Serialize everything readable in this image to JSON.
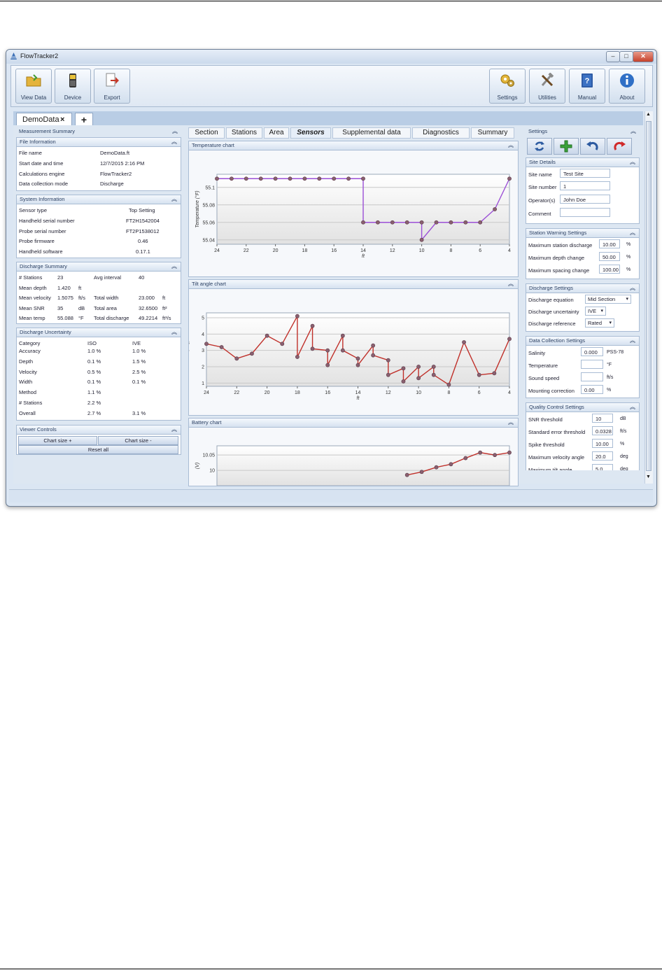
{
  "window": {
    "title": "FlowTracker2",
    "min": "–",
    "max": "□",
    "close": "✕"
  },
  "toolbar": {
    "left": [
      {
        "label": "View Data",
        "icon": "folder-icon"
      },
      {
        "label": "Device",
        "icon": "handheld-device-icon"
      },
      {
        "label": "Export",
        "icon": "export-icon"
      }
    ],
    "right": [
      {
        "label": "Settings",
        "icon": "settings-gears-icon"
      },
      {
        "label": "Utilities",
        "icon": "tools-icon"
      },
      {
        "label": "Manual",
        "icon": "manual-book-icon"
      },
      {
        "label": "About",
        "icon": "info-icon"
      }
    ]
  },
  "doc_tab": {
    "label": "DemoData",
    "close": "×",
    "add": "+"
  },
  "measurement_summary": {
    "title": "Measurement Summary"
  },
  "file_information": {
    "title": "File Information",
    "rows": [
      {
        "k": "File name",
        "v": "DemoData.ft"
      },
      {
        "k": "Start date and time",
        "v": "12/7/2015 2:16 PM"
      },
      {
        "k": "Calculations engine",
        "v": "FlowTracker2"
      },
      {
        "k": "Data collection mode",
        "v": "Discharge"
      }
    ]
  },
  "system_information": {
    "title": "System Information",
    "rows": [
      {
        "k": "Sensor type",
        "v": "Top Setting"
      },
      {
        "k": "Handheld serial number",
        "v": "FT2H1542004"
      },
      {
        "k": "Probe serial number",
        "v": "FT2P1538012"
      },
      {
        "k": "Probe firmware",
        "v": "0.46"
      },
      {
        "k": "Handheld software",
        "v": "0.17.1"
      }
    ]
  },
  "discharge_summary": {
    "title": "Discharge Summary",
    "rows": [
      {
        "k1": "# Stations",
        "v1": "23",
        "u1": "",
        "k2": "Avg interval",
        "v2": "40",
        "u2": ""
      },
      {
        "k1": "Mean depth",
        "v1": "1.420",
        "u1": "ft",
        "k2": "",
        "v2": "",
        "u2": ""
      },
      {
        "k1": "Mean velocity",
        "v1": "1.5075",
        "u1": "ft/s",
        "k2": "Total width",
        "v2": "23.000",
        "u2": "ft"
      },
      {
        "k1": "Mean SNR",
        "v1": "35",
        "u1": "dB",
        "k2": "Total area",
        "v2": "32.6500",
        "u2": "ft²"
      },
      {
        "k1": "Mean temp",
        "v1": "55.088",
        "u1": "°F",
        "k2": "Total discharge",
        "v2": "49.2214",
        "u2": "ft³/s"
      }
    ]
  },
  "discharge_uncertainty": {
    "title": "Discharge Uncertainty",
    "header": {
      "c": "Category",
      "a": "ISO",
      "b": "IVE"
    },
    "rows": [
      {
        "c": "Accuracy",
        "a": "1.0 %",
        "b": "1.0 %"
      },
      {
        "c": "Depth",
        "a": "0.1 %",
        "b": "1.5 %"
      },
      {
        "c": "Velocity",
        "a": "0.5 %",
        "b": "2.5 %"
      },
      {
        "c": "Width",
        "a": "0.1 %",
        "b": "0.1 %"
      },
      {
        "c": "Method",
        "a": "1.1 %",
        "b": ""
      },
      {
        "c": "# Stations",
        "a": "2.2 %",
        "b": ""
      },
      {
        "c": "Overall",
        "a": "2.7 %",
        "b": "3.1 %"
      }
    ]
  },
  "viewer_controls": {
    "title": "Viewer Controls",
    "chart_size_plus": "Chart size +",
    "chart_size_minus": "Chart size -",
    "reset": "Reset all"
  },
  "center_tabs": [
    "Section",
    "Stations",
    "Area",
    "Sensors",
    "Supplemental data",
    "Diagnostics",
    "Summary"
  ],
  "active_center_tab": "Sensors",
  "chart_data": [
    {
      "type": "line",
      "title": "Temperature chart",
      "xlabel": "ft",
      "ylabel": "Temperature (°F)",
      "x_ticks": [
        "24",
        "22",
        "20",
        "18",
        "16",
        "14",
        "12",
        "10",
        "8",
        "6",
        "4"
      ],
      "y_ticks": [
        "55.04",
        "55.06",
        "55.08",
        "55.1"
      ],
      "xlim": [
        24,
        4
      ],
      "ylim": [
        55.035,
        55.115
      ],
      "color": "#9b4fd6",
      "x": [
        24,
        23,
        22,
        21,
        20,
        19,
        18,
        17,
        16,
        15,
        14,
        14,
        13,
        12,
        11,
        10,
        10,
        9,
        8,
        7,
        6,
        5,
        4
      ],
      "y": [
        55.11,
        55.11,
        55.11,
        55.11,
        55.11,
        55.11,
        55.11,
        55.11,
        55.11,
        55.11,
        55.11,
        55.06,
        55.06,
        55.06,
        55.06,
        55.06,
        55.04,
        55.06,
        55.06,
        55.06,
        55.06,
        55.075,
        55.11
      ]
    },
    {
      "type": "line",
      "title": "Tilt angle chart",
      "xlabel": "ft",
      "ylabel": "Tilt (deg)",
      "x_ticks": [
        "24",
        "22",
        "20",
        "18",
        "16",
        "14",
        "12",
        "10",
        "8",
        "6",
        "4"
      ],
      "y_ticks": [
        "1",
        "2",
        "3",
        "4",
        "5"
      ],
      "xlim": [
        24,
        4
      ],
      "ylim": [
        0.8,
        5.3
      ],
      "color": "#c0302a",
      "x": [
        24,
        23,
        22,
        21,
        20,
        19,
        18,
        18,
        17,
        17,
        16,
        16,
        15,
        15,
        14,
        14,
        13,
        13,
        12,
        12,
        11,
        11,
        10,
        10,
        9,
        9,
        8,
        7,
        6,
        5,
        4
      ],
      "y": [
        3.4,
        3.2,
        2.5,
        2.8,
        3.9,
        3.4,
        5.1,
        2.6,
        4.5,
        3.1,
        3.0,
        2.1,
        3.9,
        3.0,
        2.5,
        2.1,
        3.3,
        2.7,
        2.4,
        1.5,
        1.9,
        1.1,
        2.0,
        1.3,
        2.0,
        1.5,
        0.9,
        3.5,
        1.5,
        1.6,
        3.7
      ]
    },
    {
      "type": "line",
      "title": "Battery chart",
      "xlabel": "",
      "ylabel": "(V)",
      "x_ticks": [],
      "y_ticks": [
        "10",
        "10.05"
      ],
      "xlim": [
        24,
        4
      ],
      "ylim": [
        9.95,
        10.08
      ],
      "color": "#c0302a",
      "x": [
        11,
        10,
        9,
        8,
        7,
        6,
        5,
        4
      ],
      "y": [
        9.985,
        9.995,
        10.01,
        10.02,
        10.04,
        10.058,
        10.05,
        10.058
      ]
    }
  ],
  "settings": {
    "title": "Settings",
    "toolbar_icons": [
      "refresh-icon",
      "add-icon",
      "undo-icon",
      "redo-icon"
    ],
    "site_details": {
      "title": "Site Details",
      "site_name_label": "Site name",
      "site_name": "Test Site",
      "site_number_label": "Site number",
      "site_number": "1",
      "operator_label": "Operator(s)",
      "operator": "John Doe",
      "comment_label": "Comment",
      "comment": ""
    },
    "station_warning": {
      "title": "Station Warning Settings",
      "rows": [
        {
          "k": "Maximum station discharge",
          "v": "10.00",
          "u": "%"
        },
        {
          "k": "Maximum depth change",
          "v": "50.00",
          "u": "%"
        },
        {
          "k": "Maximum spacing change",
          "v": "100.00",
          "u": "%"
        }
      ]
    },
    "discharge_settings": {
      "title": "Discharge Settings",
      "equation_label": "Discharge equation",
      "equation": "Mid Section",
      "uncertainty_label": "Discharge uncertainty",
      "uncertainty": "IVE",
      "reference_label": "Discharge reference",
      "reference": "Rated"
    },
    "data_collection": {
      "title": "Data Collection Settings",
      "rows": [
        {
          "k": "Salinity",
          "v": "0.000",
          "u": "PSS-78"
        },
        {
          "k": "Temperature",
          "v": "",
          "u": "°F"
        },
        {
          "k": "Sound speed",
          "v": "",
          "u": "ft/s"
        },
        {
          "k": "Mounting correction",
          "v": "0.00",
          "u": "%"
        }
      ]
    },
    "quality_control": {
      "title": "Quality Control Settings",
      "rows": [
        {
          "k": "SNR threshold",
          "v": "10",
          "u": "dB"
        },
        {
          "k": "Standard error threshold",
          "v": "0.0328",
          "u": "ft/s"
        },
        {
          "k": "Spike threshold",
          "v": "10.00",
          "u": "%"
        },
        {
          "k": "Maximum velocity angle",
          "v": "20.0",
          "u": "deg"
        },
        {
          "k": "Maximum tilt angle",
          "v": "5.0",
          "u": "deg"
        }
      ]
    }
  }
}
